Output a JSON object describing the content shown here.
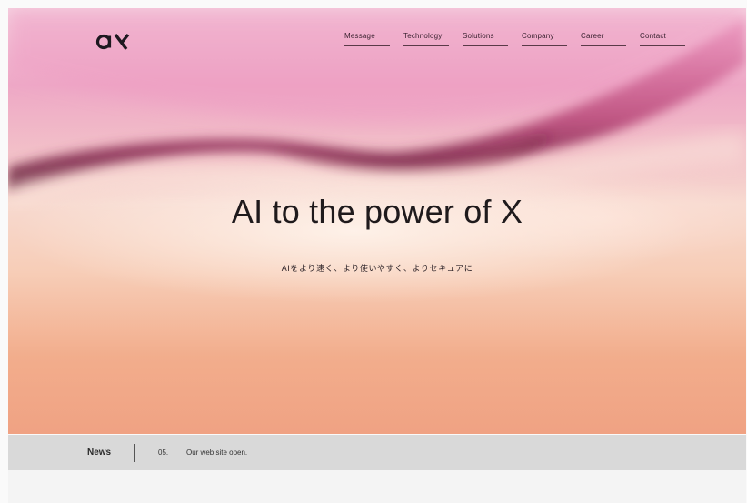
{
  "brand": {
    "logo_text": "ax"
  },
  "nav": {
    "items": [
      {
        "label": "Message"
      },
      {
        "label": "Technology"
      },
      {
        "label": "Solutions"
      },
      {
        "label": "Company"
      },
      {
        "label": "Career"
      },
      {
        "label": "Contact"
      }
    ]
  },
  "hero": {
    "headline": "AI to the power of X",
    "tagline": "AIをより速く、より使いやすく、よりセキュアに"
  },
  "news": {
    "label": "News",
    "item_number": "05.",
    "item_text": "Our web site open."
  },
  "colors": {
    "hero_pink": "#eea8c6",
    "hero_peach": "#f2ad8c",
    "news_bar": "#d9d9d9",
    "text_dark": "#1f1a1c"
  }
}
